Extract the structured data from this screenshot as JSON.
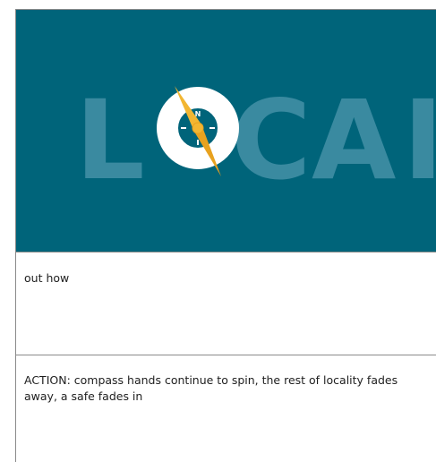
{
  "hero": {
    "visible_letters": [
      "L",
      "C",
      "A",
      "I"
    ],
    "compass_mark": "N",
    "colors": {
      "background": "#00647a",
      "lettering": "#3a8aa0",
      "compass_ring": "#ffffff",
      "needle": "#f2b632"
    },
    "icon": "compass-icon"
  },
  "rows": [
    {
      "text": "out how"
    },
    {
      "text": "ACTION: compass hands continue to spin, the rest of locality fades away, a safe fades in"
    }
  ]
}
